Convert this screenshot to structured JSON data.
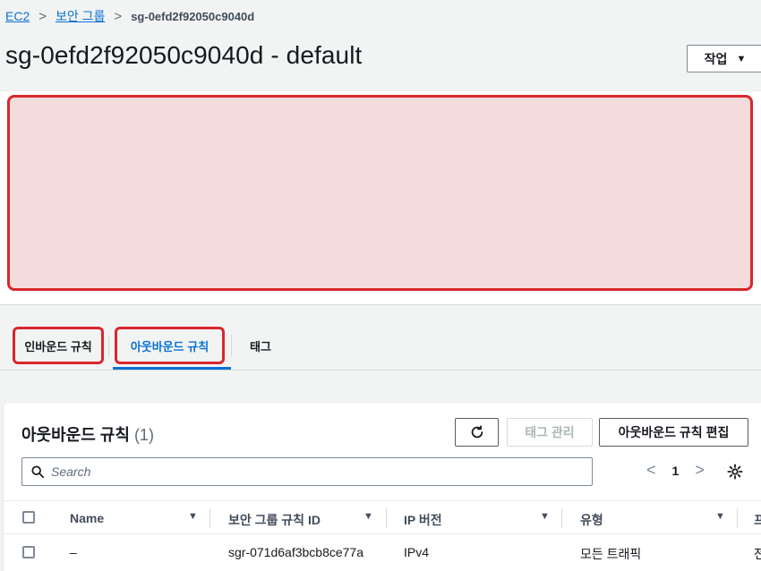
{
  "breadcrumb": {
    "ec2": "EC2",
    "security_groups": "보안 그룹",
    "current": "sg-0efd2f92050c9040d",
    "separator": ">"
  },
  "page_title": "sg-0efd2f92050c9040d - default",
  "actions_button": {
    "label": "작업",
    "caret": "▼"
  },
  "tabs": {
    "inbound": "인바운드 규칙",
    "outbound": "아웃바운드 규칙",
    "tags": "태그"
  },
  "rules_panel": {
    "title": "아웃바운드 규칙",
    "count": "(1)",
    "manage_tags": "태그 관리",
    "edit_rules": "아웃바운드 규칙 편집",
    "search_placeholder": "Search",
    "pager": {
      "prev": "<",
      "page": "1",
      "next": ">"
    },
    "columns": [
      "Name",
      "보안 그룹 규칙 ID",
      "IP 버전",
      "유형",
      "프"
    ],
    "rows": [
      {
        "name": "–",
        "rule_id": "sgr-071d6af3bcb8ce77a",
        "ip_version": "IPv4",
        "type": "모든 트래픽",
        "extra": "전"
      }
    ]
  },
  "colors": {
    "link": "#0972d3",
    "highlight": "#d8272d",
    "redacted_fill": "#f5dcdc"
  }
}
